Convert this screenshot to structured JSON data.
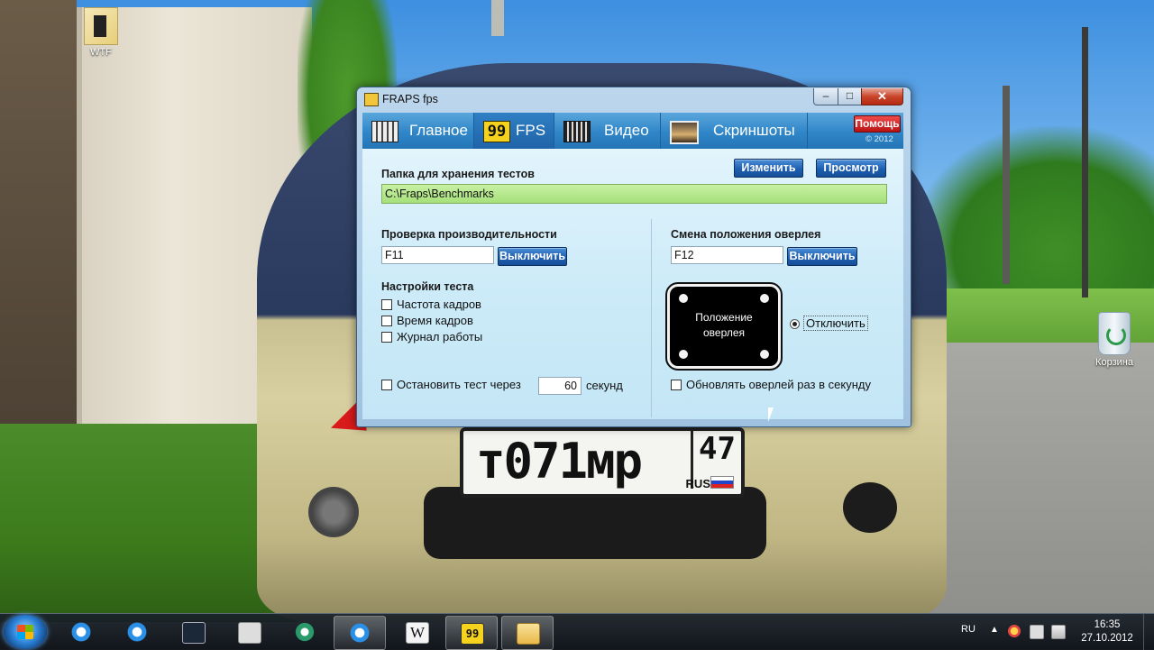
{
  "desktop": {
    "icons": [
      {
        "label": "WTF"
      },
      {
        "label": "Корзина"
      }
    ],
    "wallpaper": {
      "plate_main": "т071мр",
      "plate_region": "47",
      "plate_country": "RUS"
    }
  },
  "window": {
    "title": "FRAPS fps",
    "controls": {
      "minimize": "–",
      "maximize": "□",
      "close": "✕"
    },
    "tabs": [
      {
        "label": "Главное",
        "icon": "monitor-icon"
      },
      {
        "label": "FPS",
        "icon_text": "99",
        "active": true
      },
      {
        "label": "Видео",
        "icon": "film-icon"
      },
      {
        "label": "Скриншоты",
        "icon": "photo-icon"
      }
    ],
    "help_label": "Помощь",
    "copyright": "© 2012",
    "benchmark_folder": {
      "label": "Папка для хранения тестов",
      "value": "C:\\Fraps\\Benchmarks",
      "change_label": "Изменить",
      "browse_label": "Просмотр"
    },
    "benchmark_hotkey": {
      "label": "Проверка производительности",
      "value": "F11",
      "disable_label": "Выключить"
    },
    "benchmark_settings": {
      "label": "Настройки теста",
      "options": [
        {
          "label": "Частота кадров",
          "checked": false
        },
        {
          "label": "Время кадров",
          "checked": false
        },
        {
          "label": "Журнал работы",
          "checked": false
        }
      ],
      "stop_after": {
        "label": "Остановить тест через",
        "value": "60",
        "unit": "секунд",
        "checked": false
      }
    },
    "overlay_hotkey": {
      "label": "Смена положения оверлея",
      "value": "F12",
      "disable_label": "Выключить"
    },
    "overlay_position": {
      "line1": "Положение",
      "line2": "оверлея",
      "disable_option": "Отключить",
      "disable_selected": true
    },
    "update_overlay": {
      "label": "Обновлять оверлей раз в секунду",
      "checked": false
    }
  },
  "taskbar": {
    "apps": [
      {
        "name": "ie-icon"
      },
      {
        "name": "ie-icon"
      },
      {
        "name": "app-icon"
      },
      {
        "name": "cat-icon"
      },
      {
        "name": "recycle-app-icon"
      },
      {
        "name": "ie-icon",
        "active": true
      },
      {
        "name": "wikipedia-icon",
        "text": "W"
      },
      {
        "name": "fraps-icon",
        "text": "99",
        "active": true
      },
      {
        "name": "folder-icon",
        "active": true
      }
    ],
    "language": "RU",
    "time": "16:35",
    "date": "27.10.2012"
  },
  "colors": {
    "tab_bar": "#2f86c8",
    "folder_field": "#a6e07a",
    "blue_button": "#1e5fb2",
    "help_button": "#d02020"
  }
}
